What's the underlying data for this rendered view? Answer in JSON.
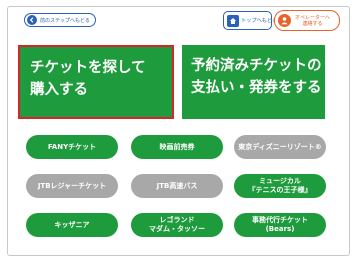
{
  "header": {
    "back_label": "前のステップへもどる",
    "home_label": "トップへもどる",
    "operator_line1": "オペレーターへ",
    "operator_line2": "連絡する"
  },
  "main_buttons": {
    "search_purchase": [
      "チケットを探して",
      "購入する"
    ],
    "reserved_pay": [
      "予約済みチケットの",
      "支払い・発券をする"
    ]
  },
  "category_buttons": [
    {
      "lines": [
        "FANYチケット"
      ],
      "enabled": true
    },
    {
      "lines": [
        "映画前売券"
      ],
      "enabled": true
    },
    {
      "lines": [
        "東京ディズニーリゾート®"
      ],
      "enabled": false
    },
    {
      "lines": [
        "JTBレジャーチケット"
      ],
      "enabled": false
    },
    {
      "lines": [
        "JTB高速バス"
      ],
      "enabled": false
    },
    {
      "lines": [
        "ミュージカル",
        "『テニスの王子様』"
      ],
      "enabled": true
    },
    {
      "lines": [
        "キッザニア"
      ],
      "enabled": true
    },
    {
      "lines": [
        "レゴランド",
        "マダム・タッソー"
      ],
      "enabled": true
    },
    {
      "lines": [
        "事務代行チケット",
        "(Bears)"
      ],
      "enabled": true
    }
  ],
  "colors": {
    "primary_green": "#1e9b3c",
    "disabled_gray": "#a8a8a8",
    "accent_blue": "#2a62b8",
    "accent_orange": "#e8622a",
    "selected_border": "#d9242a"
  }
}
